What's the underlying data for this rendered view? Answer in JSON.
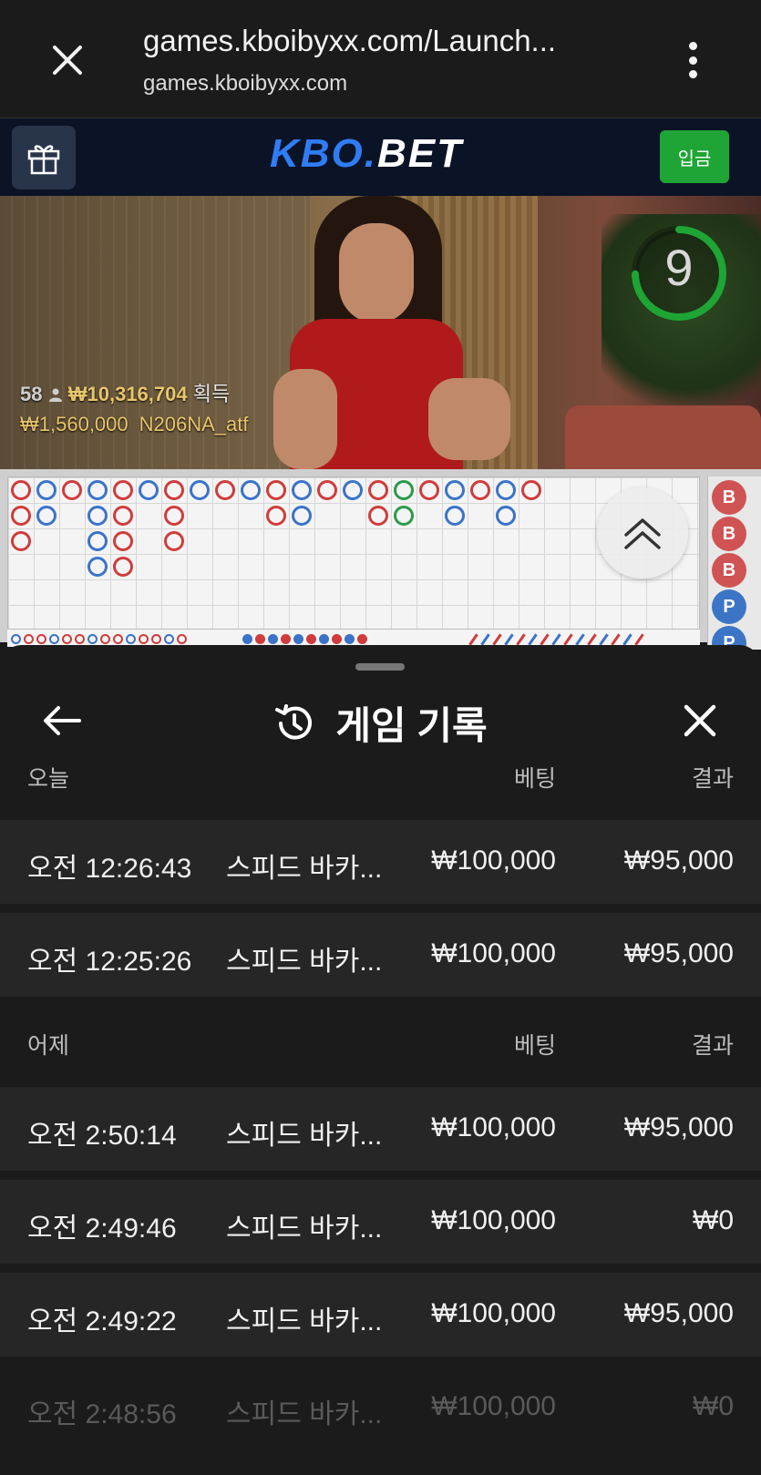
{
  "browser": {
    "title": "games.kboibyxx.com/Launch...",
    "domain": "games.kboibyxx.com"
  },
  "site": {
    "logo_left": "KBO",
    "logo_dot": ".",
    "logo_right": "BET",
    "deposit_label": "입금",
    "accent_blue": "#2f7cf6",
    "deposit_green": "#1ea535"
  },
  "video": {
    "timer_value": "9",
    "player_count": "58",
    "total_won": "₩10,316,704",
    "won_label": "획득",
    "last_win_amount": "₩1,560,000",
    "last_win_user": "N206NA_atf"
  },
  "road": {
    "side_beads": [
      "B",
      "B",
      "B",
      "P",
      "P"
    ]
  },
  "sheet": {
    "title": "게임 기록",
    "sections": [
      {
        "label": "오늘",
        "bet_header": "베팅",
        "result_header": "결과",
        "rows": [
          {
            "time": "오전 12:26:43",
            "game": "스피드 바카...",
            "bet": "₩100,000",
            "result": "₩95,000"
          },
          {
            "time": "오전 12:25:26",
            "game": "스피드 바카...",
            "bet": "₩100,000",
            "result": "₩95,000"
          }
        ]
      },
      {
        "label": "어제",
        "bet_header": "베팅",
        "result_header": "결과",
        "rows": [
          {
            "time": "오전 2:50:14",
            "game": "스피드 바카...",
            "bet": "₩100,000",
            "result": "₩95,000"
          },
          {
            "time": "오전 2:49:46",
            "game": "스피드 바카...",
            "bet": "₩100,000",
            "result": "₩0"
          },
          {
            "time": "오전 2:49:22",
            "game": "스피드 바카...",
            "bet": "₩100,000",
            "result": "₩95,000"
          },
          {
            "time": "오전 2:48:56",
            "game": "스피드 바카...",
            "bet": "₩100,000",
            "result": "₩0"
          }
        ]
      }
    ]
  },
  "icons": {
    "browser_close": "close-icon",
    "browser_menu": "more-vert-icon",
    "gift": "gift-icon",
    "history": "history-icon",
    "back": "arrow-left-icon",
    "sheet_close": "close-icon",
    "scroll_up": "double-chevron-up-icon"
  }
}
